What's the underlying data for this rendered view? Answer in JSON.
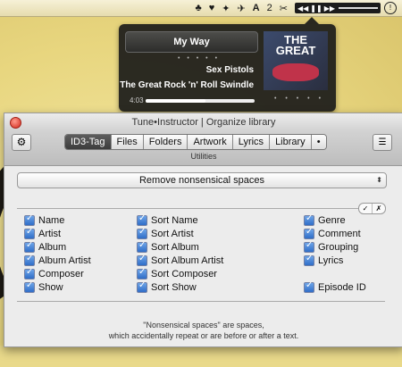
{
  "menubar": {
    "items": [
      {
        "name": "widget-icon",
        "glyph": "♣"
      },
      {
        "name": "heart-icon",
        "glyph": "♥"
      },
      {
        "name": "growl-icon",
        "glyph": "✦"
      },
      {
        "name": "bird-icon",
        "glyph": "✈"
      },
      {
        "name": "adobe-icon",
        "glyph": "A"
      },
      {
        "name": "count-badge",
        "text": "2"
      },
      {
        "name": "scissors-icon",
        "glyph": "✂"
      }
    ],
    "player_controls": [
      "◀◀",
      "❚❚",
      "▶▶"
    ],
    "alert_glyph": "!"
  },
  "now_playing": {
    "song": "My Way",
    "artist": "Sex Pistols",
    "album": "The Great Rock 'n' Roll Swindle",
    "elapsed": "4:03",
    "progress_fraction": 0.55,
    "artwork_text": "THE GREAT"
  },
  "window": {
    "title": "Tune•Instructor | Organize library",
    "toolbar_label": "Utilities",
    "tabs": [
      {
        "label": "ID3-Tag",
        "active": true
      },
      {
        "label": "Files",
        "active": false
      },
      {
        "label": "Folders",
        "active": false
      },
      {
        "label": "Artwork",
        "active": false
      },
      {
        "label": "Lyrics",
        "active": false
      },
      {
        "label": "Library",
        "active": false
      },
      {
        "label": "•",
        "active": false
      }
    ],
    "action_select": "Remove nonsensical spaces",
    "mini_buttons": [
      "✓",
      "✗"
    ],
    "fields": {
      "col1": [
        "Name",
        "Artist",
        "Album",
        "Album Artist",
        "Composer",
        "Show"
      ],
      "col2": [
        "Sort Name",
        "Sort Artist",
        "Sort Album",
        "Sort Album Artist",
        "Sort Composer",
        "Sort Show"
      ],
      "col3": [
        "Genre",
        "Comment",
        "Grouping",
        "Lyrics",
        "",
        "Episode ID"
      ]
    },
    "note_line1": "\"Nonsensical spaces\" are spaces,",
    "note_line2": "which accidentally repeat or are before or after a text."
  }
}
